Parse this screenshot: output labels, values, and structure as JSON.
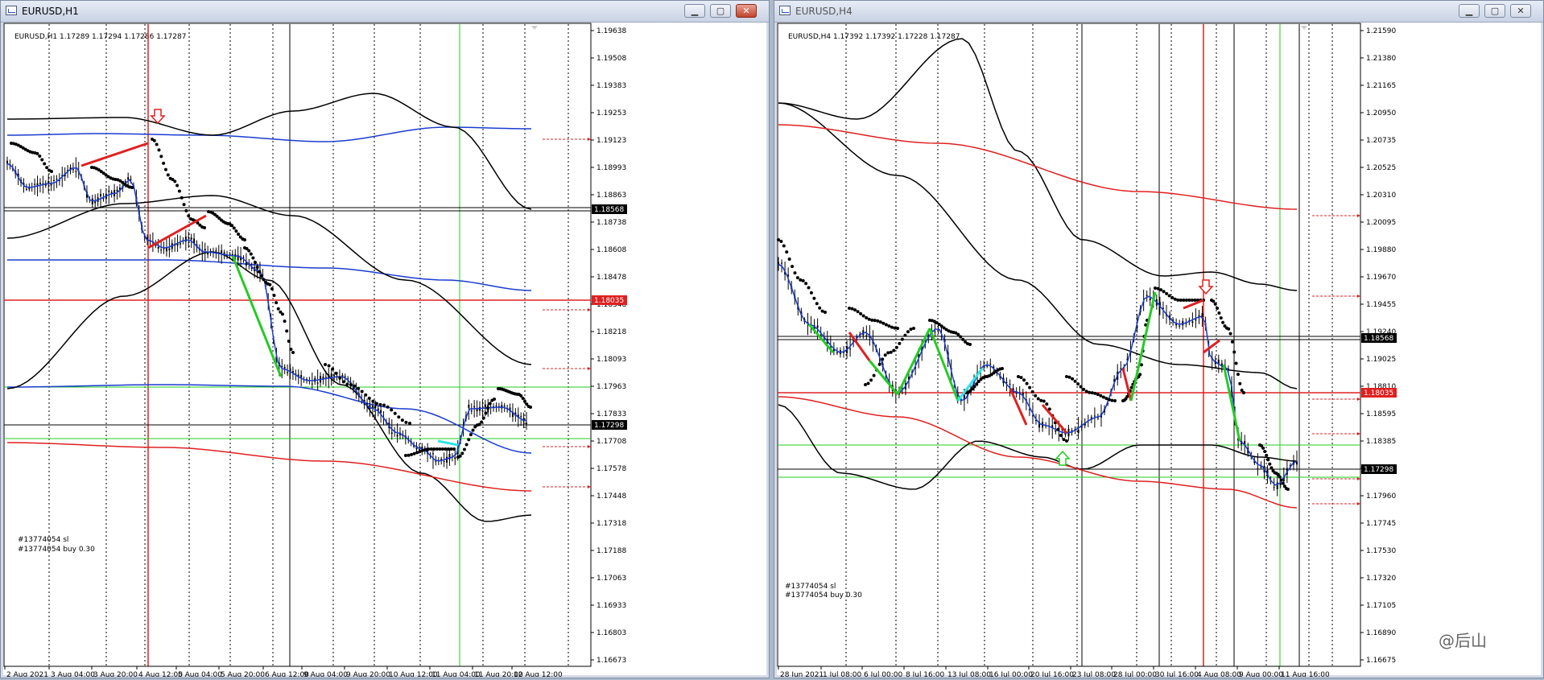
{
  "left": {
    "title": "EURUSD,H1",
    "info": "EURUSD,H1  1.17289 1.17294 1.17286 1.17287",
    "price_ticks": [
      "1.19638",
      "1.19508",
      "1.19383",
      "1.19253",
      "1.19123",
      "1.18993",
      "1.18863",
      "1.18738",
      "1.18608",
      "1.18478",
      "1.18348",
      "1.18218",
      "1.18093",
      "1.17963",
      "1.17833",
      "1.17708",
      "1.17578",
      "1.17448",
      "1.17318",
      "1.17188",
      "1.17063",
      "1.16933",
      "1.16803",
      "1.16673"
    ],
    "time_ticks": [
      "2 Aug 2021",
      "3 Aug 04:00",
      "3 Aug 20:00",
      "4 Aug 12:00",
      "5 Aug 04:00",
      "5 Aug 20:00",
      "6 Aug 12:00",
      "9 Aug 04:00",
      "9 Aug 20:00",
      "10 Aug 12:00",
      "11 Aug 04:00",
      "11 Aug 20:00",
      "12 Aug 12:00"
    ],
    "price_tags": {
      "black": "1.18568",
      "red": "1.18035",
      "current": "1.17298"
    },
    "order_sl": "#13774054 sl",
    "order_buy": "#13774054 buy 0.30"
  },
  "right": {
    "title": "EURUSD,H4",
    "info": "EURUSD,H4  1.17392 1.17392 1.17228 1.17287",
    "price_ticks": [
      "1.21590",
      "1.21380",
      "1.21165",
      "1.20950",
      "1.20735",
      "1.20525",
      "1.20310",
      "1.20095",
      "1.19880",
      "1.19670",
      "1.19455",
      "1.19240",
      "1.19025",
      "1.18810",
      "1.18595",
      "1.18385",
      "1.18170",
      "1.17960",
      "1.17745",
      "1.17530",
      "1.17320",
      "1.17105",
      "1.16890",
      "1.16675"
    ],
    "time_ticks": [
      "28 Jun 2021",
      "1 Jul 08:00",
      "6 Jul 00:00",
      "8 Jul 16:00",
      "13 Jul 08:00",
      "16 Jul 00:00",
      "20 Jul 16:00",
      "23 Jul 08:00",
      "28 Jul 00:00",
      "30 Jul 16:00",
      "4 Aug 08:00",
      "9 Aug 00:00",
      "11 Aug 16:00"
    ],
    "price_tags": {
      "black": "1.18568",
      "red": "1.18035",
      "current": "1.17298"
    },
    "order_sl": "#13774054 sl",
    "order_buy": "#13774054 buy 0.30",
    "watermark": "@后山"
  },
  "colors": {
    "bull": "#22cc22",
    "bear": "#e02020",
    "ma_blue": "#1a3ccf",
    "band": "#000000",
    "cyan": "#2ee6e6"
  }
}
